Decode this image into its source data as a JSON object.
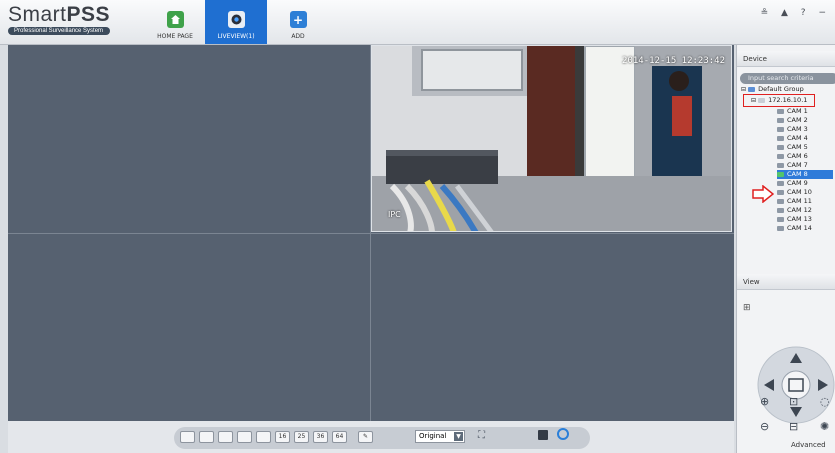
{
  "app": {
    "logo_main": "SmartPSS",
    "logo_sub": "Professional Surveillance System",
    "window_controls": "≗ ▲ ? −"
  },
  "nav": {
    "home_label": "HOME PAGE",
    "liveview_label": "LIVEVIEW(1)",
    "add_label": "ADD"
  },
  "video": {
    "timestamp": "2014-12-15 12:23:42",
    "osd_label": "IPC"
  },
  "toolbar": {
    "layouts": [
      "",
      "",
      "",
      "",
      "",
      "16",
      "25",
      "36",
      "64"
    ],
    "display_mode": "Original"
  },
  "device_panel": {
    "header": "Device",
    "search_placeholder": "Input search criteria",
    "group": "Default Group",
    "device": "172.16.10.1",
    "cameras": [
      "CAM 1",
      "CAM 2",
      "CAM 3",
      "CAM 4",
      "CAM 5",
      "CAM 6",
      "CAM 7",
      "CAM 8",
      "CAM 9",
      "CAM 10",
      "CAM 11",
      "CAM 12",
      "CAM 13",
      "CAM 14"
    ],
    "selected_camera": "CAM 8"
  },
  "view_panel": {
    "header": "View",
    "advanced_label": "Advanced"
  },
  "colors": {
    "accent": "#1f6fd1",
    "grid_bg": "#566170",
    "highlight_red": "#e02020"
  }
}
